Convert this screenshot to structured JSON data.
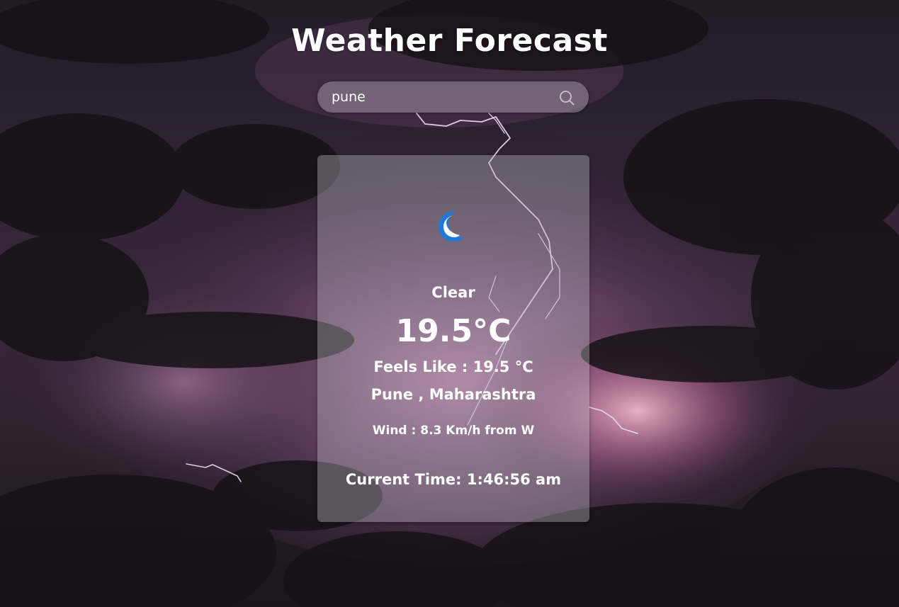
{
  "header": {
    "title": "Weather Forecast"
  },
  "search": {
    "value": "pune",
    "icon": "search-icon"
  },
  "weather": {
    "icon": "crescent-moon-icon",
    "icon_color": "#1e7ad6",
    "condition": "Clear",
    "temperature": "19.5°C",
    "feels_like": "Feels Like : 19.5 °C",
    "location": "Pune , Maharashtra",
    "wind": "Wind : 8.3 Km/h from W",
    "current_time": "Current Time: 1:46:56 am"
  },
  "background": {
    "theme": "stormy night sky with lightning",
    "colors": [
      "#1c1620",
      "#5a3a5e",
      "#c88fb8"
    ]
  }
}
